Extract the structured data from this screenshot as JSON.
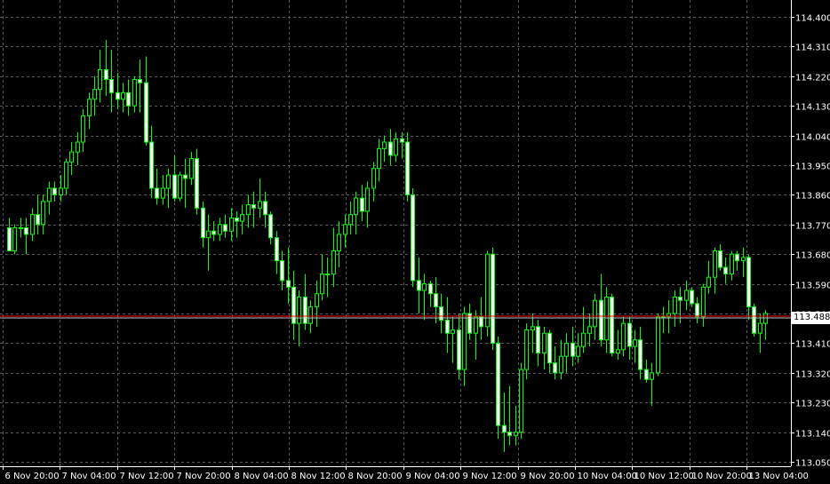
{
  "chart_data": {
    "type": "candlestick",
    "title": "",
    "xlabel": "",
    "ylabel": "",
    "ylim": [
      113.02,
      114.43
    ],
    "yticks": [
      "114.400",
      "114.310",
      "114.220",
      "114.130",
      "114.040",
      "113.950",
      "113.860",
      "113.770",
      "113.680",
      "113.590",
      "113.500",
      "113.410",
      "113.320",
      "113.230",
      "113.140",
      "113.050"
    ],
    "xticks": [
      "6 Nov 20:00",
      "7 Nov 04:00",
      "7 Nov 12:00",
      "7 Nov 20:00",
      "8 Nov 04:00",
      "8 Nov 12:00",
      "8 Nov 20:00",
      "9 Nov 04:00",
      "9 Nov 12:00",
      "9 Nov 20:00",
      "10 Nov 04:00",
      "10 Nov 12:00",
      "10 Nov 20:00",
      "13 Nov 04:00"
    ],
    "grid": true,
    "current_price": "113.488",
    "colors": {
      "background": "#000000",
      "grid": "#5a5a5a",
      "candle": "#00ff00",
      "axis_text": "#ffffff",
      "price_line": "#ff0000"
    },
    "series": [
      {
        "ohlc": [
          [
            113.76,
            113.79,
            113.69,
            113.69
          ],
          [
            113.69,
            113.77,
            113.68,
            113.76
          ],
          [
            113.76,
            113.79,
            113.73,
            113.76
          ],
          [
            113.76,
            113.79,
            113.68,
            113.74
          ],
          [
            113.74,
            113.82,
            113.72,
            113.8
          ],
          [
            113.8,
            113.86,
            113.74,
            113.77
          ],
          [
            113.77,
            113.86,
            113.74,
            113.84
          ],
          [
            113.84,
            113.9,
            113.8,
            113.88
          ],
          [
            113.88,
            113.9,
            113.84,
            113.86
          ],
          [
            113.86,
            113.92,
            113.84,
            113.88
          ],
          [
            113.88,
            113.97,
            113.86,
            113.96
          ],
          [
            113.96,
            114.02,
            113.92,
            113.99
          ],
          [
            113.99,
            114.05,
            113.95,
            114.02
          ],
          [
            114.02,
            114.12,
            113.99,
            114.1
          ],
          [
            114.1,
            114.17,
            114.06,
            114.15
          ],
          [
            114.15,
            114.22,
            114.1,
            114.18
          ],
          [
            114.18,
            114.3,
            114.14,
            114.24
          ],
          [
            114.24,
            114.33,
            114.16,
            114.21
          ],
          [
            114.21,
            114.3,
            114.11,
            114.17
          ],
          [
            114.17,
            114.23,
            114.12,
            114.15
          ],
          [
            114.15,
            114.2,
            114.11,
            114.17
          ],
          [
            114.17,
            114.21,
            114.1,
            114.13
          ],
          [
            114.13,
            114.22,
            114.11,
            114.21
          ],
          [
            114.21,
            114.27,
            114.11,
            114.2
          ],
          [
            114.2,
            114.28,
            114.01,
            114.02
          ],
          [
            114.02,
            114.07,
            113.85,
            113.88
          ],
          [
            113.88,
            113.94,
            113.83,
            113.85
          ],
          [
            113.85,
            113.92,
            113.83,
            113.88
          ],
          [
            113.88,
            113.94,
            113.82,
            113.92
          ],
          [
            113.92,
            113.98,
            113.84,
            113.85
          ],
          [
            113.85,
            113.93,
            113.84,
            113.92
          ],
          [
            113.92,
            113.97,
            113.82,
            113.91
          ],
          [
            113.91,
            113.99,
            113.89,
            113.97
          ],
          [
            113.97,
            114.0,
            113.8,
            113.82
          ],
          [
            113.82,
            113.84,
            113.7,
            113.73
          ],
          [
            113.73,
            113.8,
            113.63,
            113.75
          ],
          [
            113.75,
            113.78,
            113.72,
            113.74
          ],
          [
            113.74,
            113.79,
            113.72,
            113.77
          ],
          [
            113.77,
            113.8,
            113.73,
            113.75
          ],
          [
            113.75,
            113.82,
            113.72,
            113.79
          ],
          [
            113.79,
            113.81,
            113.73,
            113.78
          ],
          [
            113.78,
            113.83,
            113.74,
            113.8
          ],
          [
            113.8,
            113.86,
            113.76,
            113.83
          ],
          [
            113.83,
            113.87,
            113.76,
            113.82
          ],
          [
            113.82,
            113.91,
            113.79,
            113.84
          ],
          [
            113.84,
            113.87,
            113.76,
            113.8
          ],
          [
            113.8,
            113.81,
            113.71,
            113.73
          ],
          [
            113.73,
            113.75,
            113.62,
            113.66
          ],
          [
            113.66,
            113.69,
            113.57,
            113.6
          ],
          [
            113.6,
            113.7,
            113.53,
            113.58
          ],
          [
            113.58,
            113.63,
            113.42,
            113.47
          ],
          [
            113.47,
            113.57,
            113.4,
            113.55
          ],
          [
            113.55,
            113.62,
            113.45,
            113.47
          ],
          [
            113.47,
            113.54,
            113.44,
            113.52
          ],
          [
            113.52,
            113.6,
            113.46,
            113.56
          ],
          [
            113.56,
            113.68,
            113.54,
            113.62
          ],
          [
            113.62,
            113.67,
            113.55,
            113.62
          ],
          [
            113.62,
            113.76,
            113.58,
            113.69
          ],
          [
            113.69,
            113.78,
            113.64,
            113.74
          ],
          [
            113.74,
            113.8,
            113.7,
            113.77
          ],
          [
            113.77,
            113.84,
            113.74,
            113.8
          ],
          [
            113.8,
            113.87,
            113.74,
            113.85
          ],
          [
            113.85,
            113.89,
            113.78,
            113.81
          ],
          [
            113.81,
            113.9,
            113.76,
            113.88
          ],
          [
            113.88,
            113.96,
            113.84,
            113.94
          ],
          [
            113.94,
            114.03,
            113.9,
            114.0
          ],
          [
            114.0,
            114.04,
            113.96,
            114.02
          ],
          [
            114.02,
            114.06,
            113.95,
            113.98
          ],
          [
            113.98,
            114.05,
            113.96,
            114.03
          ],
          [
            114.03,
            114.05,
            113.97,
            114.02
          ],
          [
            114.02,
            114.05,
            113.84,
            113.86
          ],
          [
            113.86,
            113.88,
            113.58,
            113.6
          ],
          [
            113.6,
            113.67,
            113.5,
            113.57
          ],
          [
            113.57,
            113.62,
            113.48,
            113.59
          ],
          [
            113.59,
            113.6,
            113.52,
            113.56
          ],
          [
            113.56,
            113.61,
            113.47,
            113.52
          ],
          [
            113.52,
            113.56,
            113.44,
            113.48
          ],
          [
            113.48,
            113.55,
            113.38,
            113.44
          ],
          [
            113.44,
            113.49,
            113.35,
            113.45
          ],
          [
            113.45,
            113.5,
            113.3,
            113.33
          ],
          [
            113.33,
            113.52,
            113.28,
            113.5
          ],
          [
            113.5,
            113.53,
            113.42,
            113.44
          ],
          [
            113.44,
            113.51,
            113.36,
            113.49
          ],
          [
            113.49,
            113.55,
            113.42,
            113.46
          ],
          [
            113.46,
            113.69,
            113.43,
            113.68
          ],
          [
            113.68,
            113.7,
            113.39,
            113.41
          ],
          [
            113.41,
            113.43,
            113.12,
            113.16
          ],
          [
            113.16,
            113.26,
            113.08,
            113.14
          ],
          [
            113.14,
            113.28,
            113.1,
            113.13
          ],
          [
            113.13,
            113.22,
            113.1,
            113.14
          ],
          [
            113.14,
            113.35,
            113.12,
            113.33
          ],
          [
            113.33,
            113.47,
            113.3,
            113.45
          ],
          [
            113.45,
            113.5,
            113.38,
            113.46
          ],
          [
            113.46,
            113.48,
            113.34,
            113.38
          ],
          [
            113.38,
            113.46,
            113.33,
            113.44
          ],
          [
            113.44,
            113.45,
            113.32,
            113.35
          ],
          [
            113.35,
            113.4,
            113.3,
            113.32
          ],
          [
            113.32,
            113.42,
            113.3,
            113.37
          ],
          [
            113.37,
            113.44,
            113.32,
            113.41
          ],
          [
            113.41,
            113.46,
            113.34,
            113.37
          ],
          [
            113.37,
            113.44,
            113.35,
            113.4
          ],
          [
            113.4,
            113.52,
            113.38,
            113.44
          ],
          [
            113.44,
            113.5,
            113.4,
            113.46
          ],
          [
            113.46,
            113.56,
            113.42,
            113.54
          ],
          [
            113.54,
            113.62,
            113.4,
            113.42
          ],
          [
            113.42,
            113.58,
            113.38,
            113.55
          ],
          [
            113.55,
            113.56,
            113.37,
            113.38
          ],
          [
            113.38,
            113.45,
            113.36,
            113.39
          ],
          [
            113.39,
            113.49,
            113.37,
            113.47
          ],
          [
            113.47,
            113.49,
            113.36,
            113.4
          ],
          [
            113.4,
            113.45,
            113.35,
            113.42
          ],
          [
            113.42,
            113.46,
            113.3,
            113.33
          ],
          [
            113.33,
            113.36,
            113.29,
            113.3
          ],
          [
            113.3,
            113.35,
            113.22,
            113.32
          ],
          [
            113.32,
            113.5,
            113.31,
            113.49
          ],
          [
            113.49,
            113.52,
            113.44,
            113.49
          ],
          [
            113.49,
            113.54,
            113.44,
            113.5
          ],
          [
            113.5,
            113.57,
            113.46,
            113.55
          ],
          [
            113.55,
            113.58,
            113.47,
            113.54
          ],
          [
            113.54,
            113.6,
            113.51,
            113.57
          ],
          [
            113.57,
            113.58,
            113.52,
            113.53
          ],
          [
            113.53,
            113.55,
            113.47,
            113.49
          ],
          [
            113.49,
            113.59,
            113.46,
            113.58
          ],
          [
            113.58,
            113.66,
            113.56,
            113.61
          ],
          [
            113.61,
            113.7,
            113.56,
            113.69
          ],
          [
            113.69,
            113.71,
            113.63,
            113.64
          ],
          [
            113.64,
            113.67,
            113.59,
            113.62
          ],
          [
            113.62,
            113.69,
            113.6,
            113.68
          ],
          [
            113.68,
            113.69,
            113.63,
            113.66
          ],
          [
            113.66,
            113.7,
            113.61,
            113.67
          ],
          [
            113.67,
            113.68,
            113.48,
            113.52
          ],
          [
            113.52,
            113.53,
            113.43,
            113.44
          ],
          [
            113.44,
            113.5,
            113.38,
            113.47
          ],
          [
            113.47,
            113.51,
            113.42,
            113.5
          ]
        ]
      }
    ]
  }
}
